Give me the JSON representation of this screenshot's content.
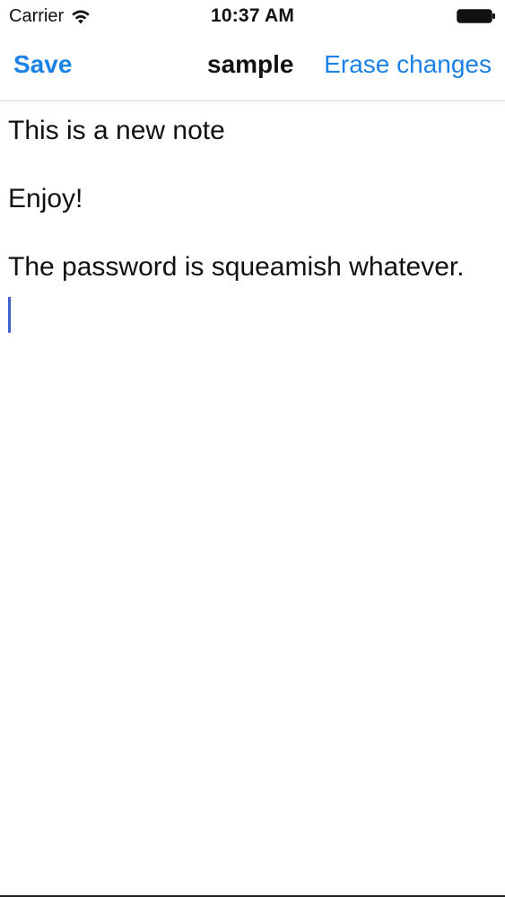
{
  "status_bar": {
    "carrier": "Carrier",
    "time": "10:37 AM",
    "wifi_icon": "wifi-icon",
    "battery_icon": "battery-icon"
  },
  "nav_bar": {
    "save_label": "Save",
    "title": "sample",
    "erase_label": "Erase changes"
  },
  "editor": {
    "lines": [
      "This is a new note",
      "",
      "Enjoy!",
      "",
      "The password is squeamish whatever.",
      ""
    ]
  },
  "colors": {
    "accent": "#1a82e6",
    "cursor": "#3f64d0",
    "text": "#111111",
    "background": "#ffffff"
  }
}
